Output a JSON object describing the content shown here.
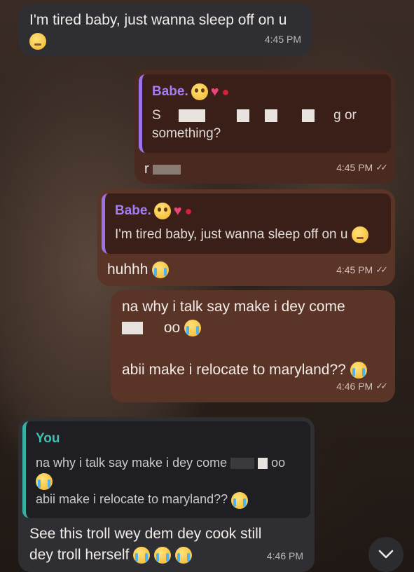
{
  "messages": {
    "m1": {
      "text": "I'm tired baby, just wanna sleep off on u",
      "time": "4:45 PM"
    },
    "m2": {
      "quote_name": "Babe.",
      "quote_text_line1": "S",
      "quote_text_tail": "g or",
      "quote_text_line2": "something?",
      "body_partial": "r",
      "time": "4:45 PM"
    },
    "m3": {
      "quote_name": "Babe.",
      "quote_text": "I'm tired baby, just wanna sleep off on u",
      "text": "huhhh",
      "time": "4:45 PM"
    },
    "m4": {
      "line1": "na why i talk say make i dey come",
      "line2_tail": "oo",
      "line3": "abii make i relocate to maryland??",
      "time": "4:46 PM"
    },
    "m5": {
      "quote_name": "You",
      "quote_line1": "na why i talk say make i dey come",
      "quote_line1_tail": "oo",
      "quote_line3": "abii make i relocate to maryland??",
      "line1": "See this troll wey dem dey cook still",
      "line2": "dey troll herself",
      "time": "4:46 PM"
    }
  },
  "icons": {
    "read_receipt": "double-check-icon",
    "scroll_down": "chevron-down-icon"
  },
  "colors": {
    "incoming_bubble": "#2f2f33",
    "outgoing_bubble": "#5b3428",
    "quote_accent_partner": "#9b73e8",
    "quote_accent_you": "#35b0a3"
  }
}
